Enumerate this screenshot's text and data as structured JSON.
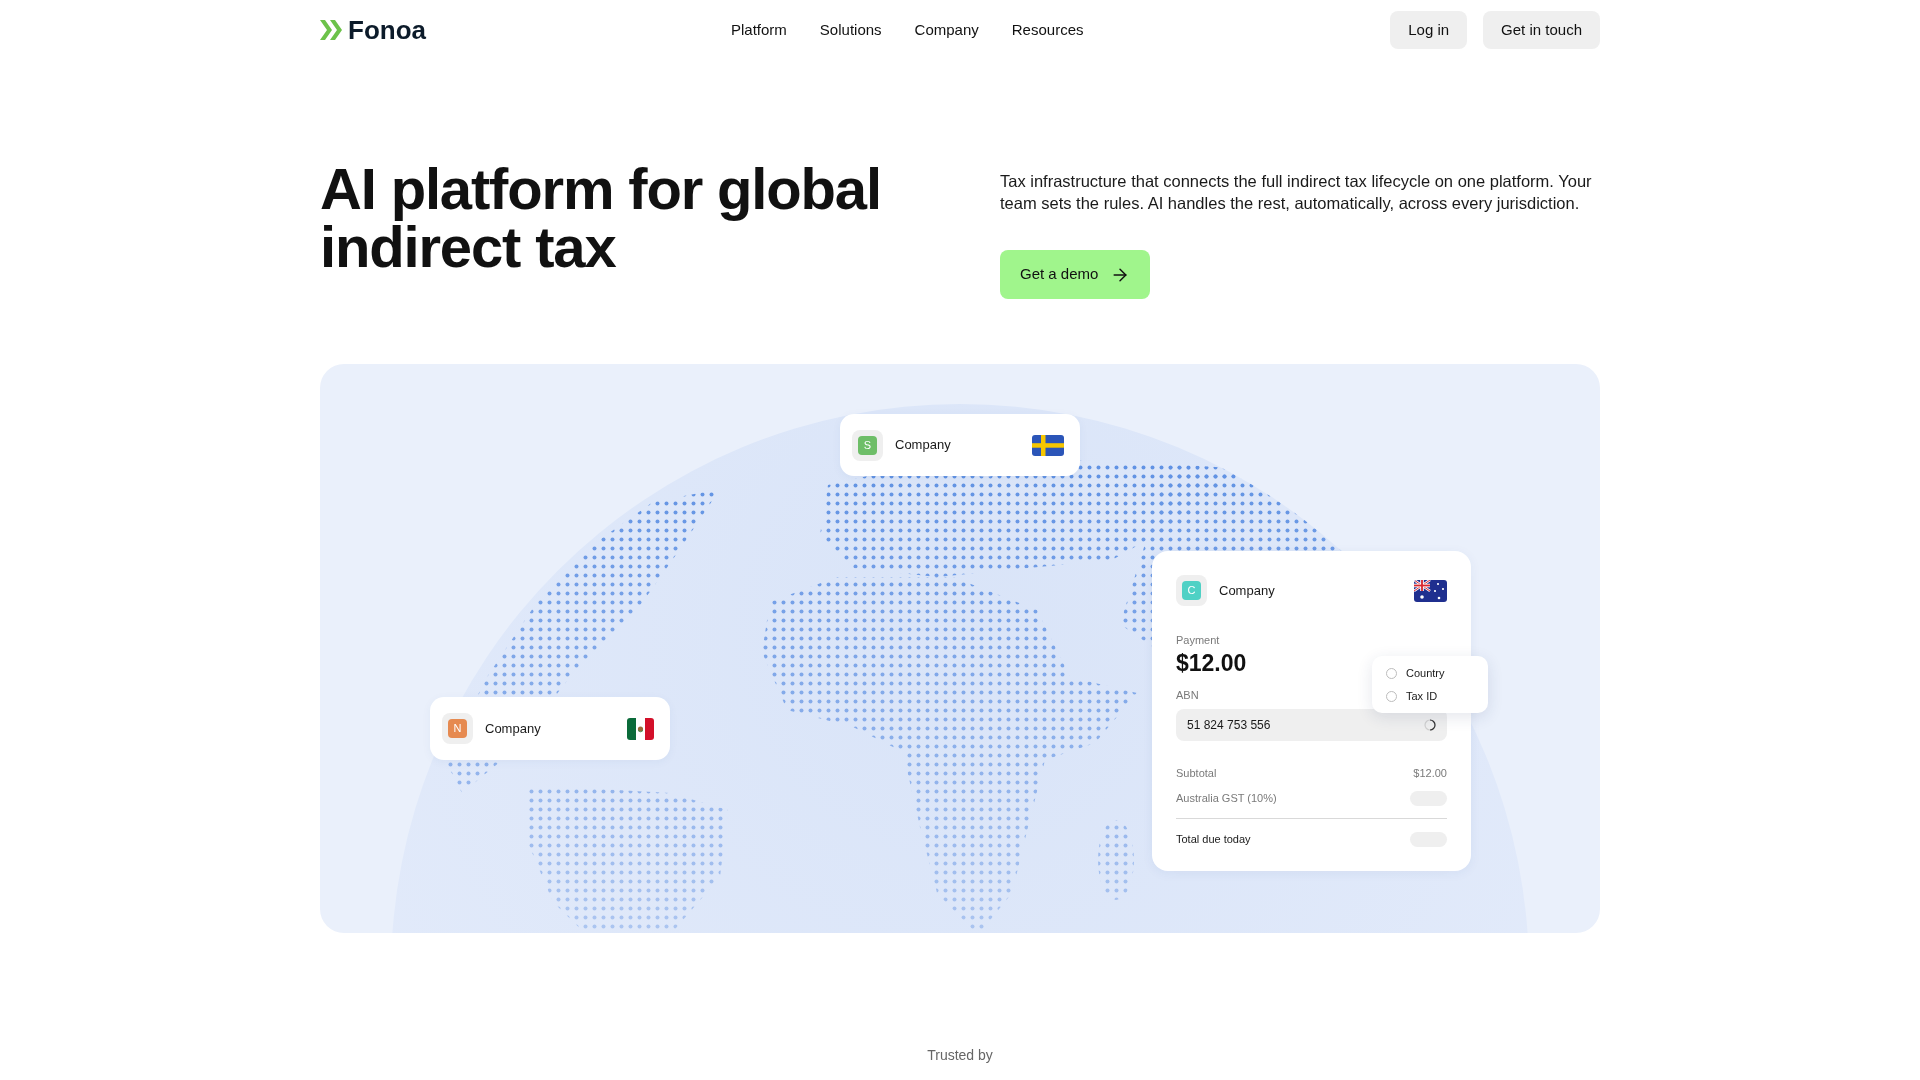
{
  "header": {
    "logo": "Fonoa",
    "nav": [
      "Platform",
      "Solutions",
      "Company",
      "Resources"
    ],
    "actions": [
      "Log in",
      "Get in touch"
    ]
  },
  "hero": {
    "title": "AI platform for global indirect tax",
    "description": "Tax infrastructure that connects the full indirect tax lifecycle on one platform. Your team sets the rules. AI handles the rest, automatically, across every jurisdiction.",
    "cta": "Get a demo"
  },
  "showcase": {
    "cards": [
      {
        "kind": "compact",
        "initial": "S",
        "color": "#6ebe68",
        "name": "Company"
      },
      {
        "kind": "payment",
        "initial": "C",
        "color": "#4fd1c5",
        "name": "Company",
        "payment_label": "Payment",
        "amount": "$12.00",
        "abn": {
          "label": "ABN",
          "value": "51 824 753 556",
          "loading": true
        },
        "lines": [
          {
            "kind": "item",
            "label": "Subtotal",
            "value": "$12.00",
            "loading": false
          },
          {
            "kind": "item",
            "label": "Australia GST (10%)",
            "loading": true
          },
          {
            "kind": "total",
            "label": "Total due today",
            "loading": true
          }
        ],
        "popover": {
          "options": [
            {
              "label": "Country",
              "selected": false
            },
            {
              "label": "Tax ID",
              "selected": false
            }
          ]
        }
      },
      {
        "kind": "compact",
        "initial": "N",
        "color": "#e68a50",
        "name": "Company"
      }
    ]
  },
  "trusted_by": "Trusted by"
}
